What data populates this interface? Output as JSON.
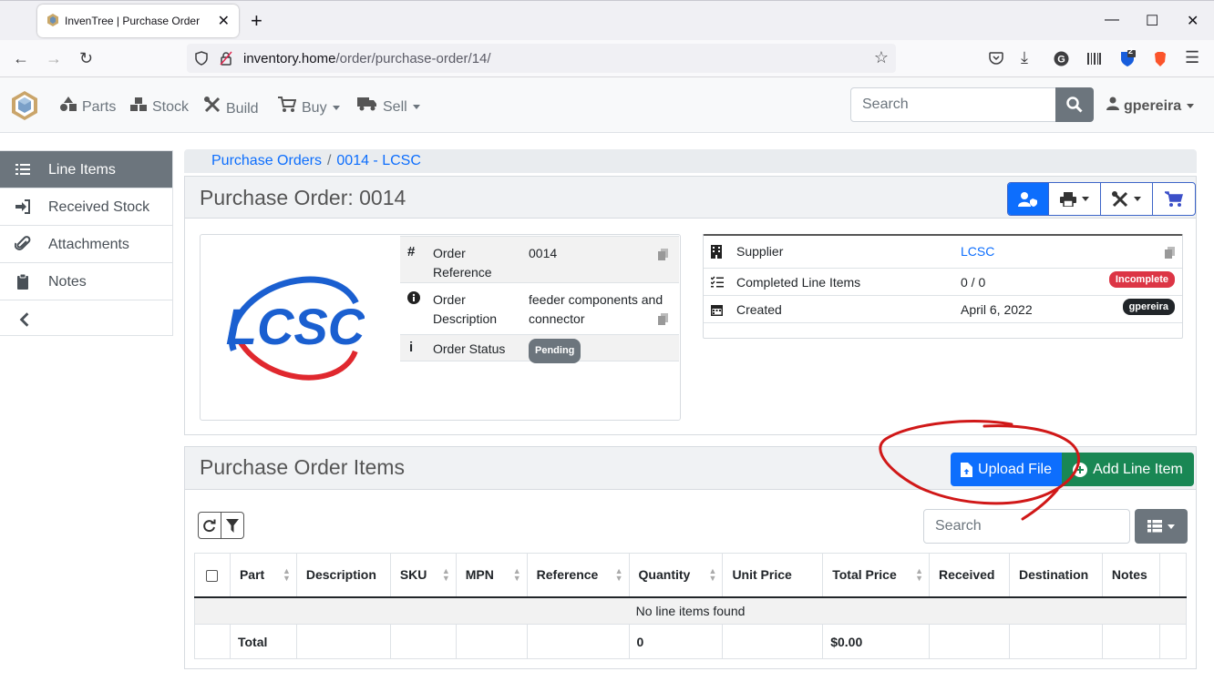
{
  "browser": {
    "tab_title": "InvenTree | Purchase Order",
    "url_host": "inventory.home",
    "url_path": "/order/purchase-order/14/",
    "ext_badge": "2"
  },
  "nav": {
    "parts": "Parts",
    "stock": "Stock",
    "build": "Build",
    "buy": "Buy",
    "sell": "Sell",
    "search_placeholder": "Search",
    "user": "gpereira"
  },
  "sidebar": {
    "items": [
      {
        "label": "Line Items"
      },
      {
        "label": "Received Stock"
      },
      {
        "label": "Attachments"
      },
      {
        "label": "Notes"
      }
    ]
  },
  "breadcrumb": {
    "root": "Purchase Orders",
    "current": "0014 - LCSC"
  },
  "order": {
    "title": "Purchase Order: 0014",
    "logo_text": "LCSC",
    "reference_label": "Order Reference",
    "reference": "0014",
    "description_label": "Order Description",
    "description": "feeder components and connector",
    "status_label": "Order Status",
    "status": "Pending"
  },
  "supplier": {
    "supplier_label": "Supplier",
    "supplier": "LCSC",
    "completed_label": "Completed Line Items",
    "completed": "0 / 0",
    "completed_badge": "Incomplete",
    "created_label": "Created",
    "created": "April 6, 2022",
    "created_by": "gpereira"
  },
  "items": {
    "title": "Purchase Order Items",
    "upload_label": "Upload File",
    "add_label": "Add Line Item",
    "search_placeholder": "Search",
    "columns": [
      "Part",
      "Description",
      "SKU",
      "MPN",
      "Reference",
      "Quantity",
      "Unit Price",
      "Total Price",
      "Received",
      "Destination",
      "Notes"
    ],
    "empty_message": "No line items found",
    "total_label": "Total",
    "total_quantity": "0",
    "total_price": "$0.00"
  },
  "colors": {
    "primary": "#0d6efd",
    "success": "#198754",
    "danger": "#dc3545",
    "annotation": "#d01818"
  }
}
